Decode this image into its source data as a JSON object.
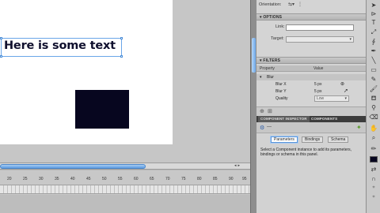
{
  "stage": {
    "text_content": "Here is some text"
  },
  "properties": {
    "orientation_label": "Orientation:",
    "options_header": "OPTIONS",
    "link_label": "Link:",
    "link_value": "",
    "target_label": "Target:",
    "target_value": "",
    "filters_header": "FILTERS",
    "table_headers": [
      "Property",
      "Value"
    ],
    "filter_group": "Blur",
    "filter_rows": [
      {
        "name": "Blur X",
        "value": "5 px"
      },
      {
        "name": "Blur Y",
        "value": "5 px"
      },
      {
        "name": "Quality",
        "value": "Low"
      }
    ]
  },
  "inspector": {
    "tabs": [
      "COMPONENT INSPECTOR",
      "COMPONENTS"
    ],
    "sub_tabs": [
      "Parameters",
      "Bindings",
      "Schema"
    ],
    "active_sub_tab": "Parameters",
    "description": "Select a Component instance to add its parameters, bindings or schema in this panel."
  },
  "timeline": {
    "ruler_labels": [
      "20",
      "25",
      "30",
      "35",
      "40",
      "45",
      "50",
      "55",
      "60",
      "65",
      "70",
      "75",
      "80",
      "85",
      "90",
      "95"
    ]
  },
  "colors": {
    "text_fill": "#10102e",
    "rectangle_fill": "#07061f",
    "selection_blue": "#6aa6e8"
  },
  "icons": [
    "chevron-down-icon",
    "link-icon",
    "eye-icon",
    "lock-icon",
    "pencil-icon",
    "brush-icon",
    "paint-bucket-icon",
    "eraser-icon",
    "hand-icon",
    "zoom-icon",
    "text-tool-icon",
    "arrow-tool-icon"
  ]
}
